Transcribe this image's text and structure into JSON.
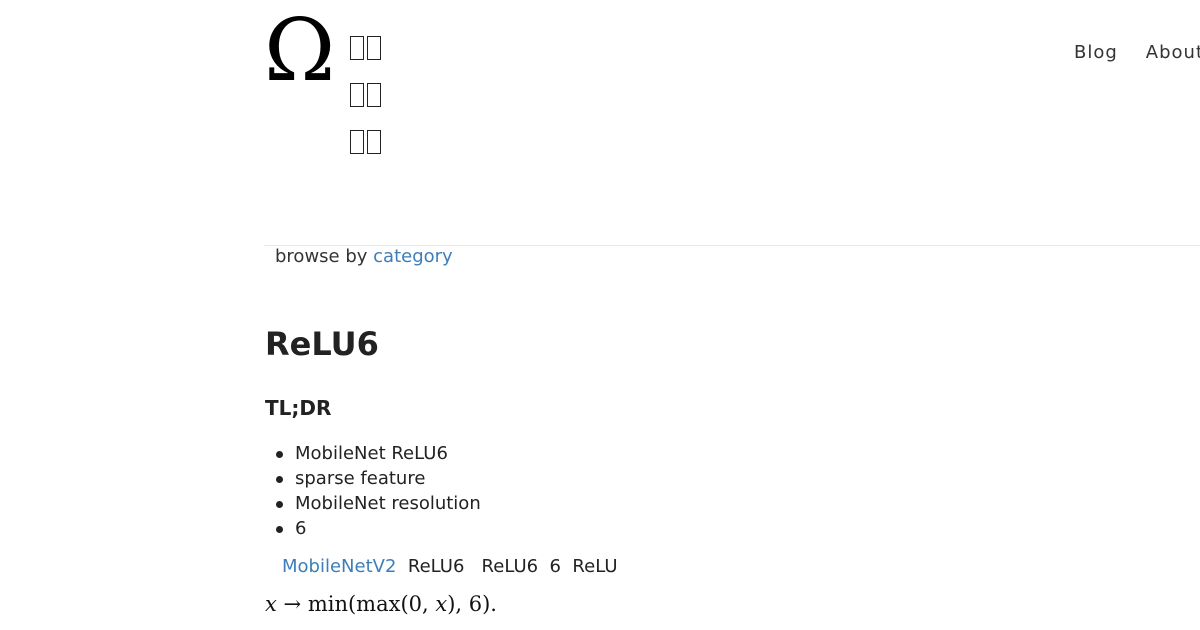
{
  "header": {
    "logo": "Ω",
    "site_title_lines": [
      "",
      "",
      ""
    ],
    "nav": [
      {
        "label": "Blog"
      },
      {
        "label": "About"
      }
    ]
  },
  "browse": {
    "prefix": "browse by",
    "link_label": "category"
  },
  "post": {
    "title": "ReLU6",
    "tldr_heading": "TL;DR",
    "tldr_items": [
      "MobileNet  ReLU6",
      " sparse feature",
      "MobileNet  resolution",
      " 6"
    ],
    "intro_link": "MobileNetV2",
    "intro_rest": "  ReLU6   ReLU6  6  ReLU",
    "formula": {
      "var": "x",
      "arrow": "→",
      "expr": "min(max(0, ",
      "var2": "x",
      "tail": "), 6)."
    }
  }
}
